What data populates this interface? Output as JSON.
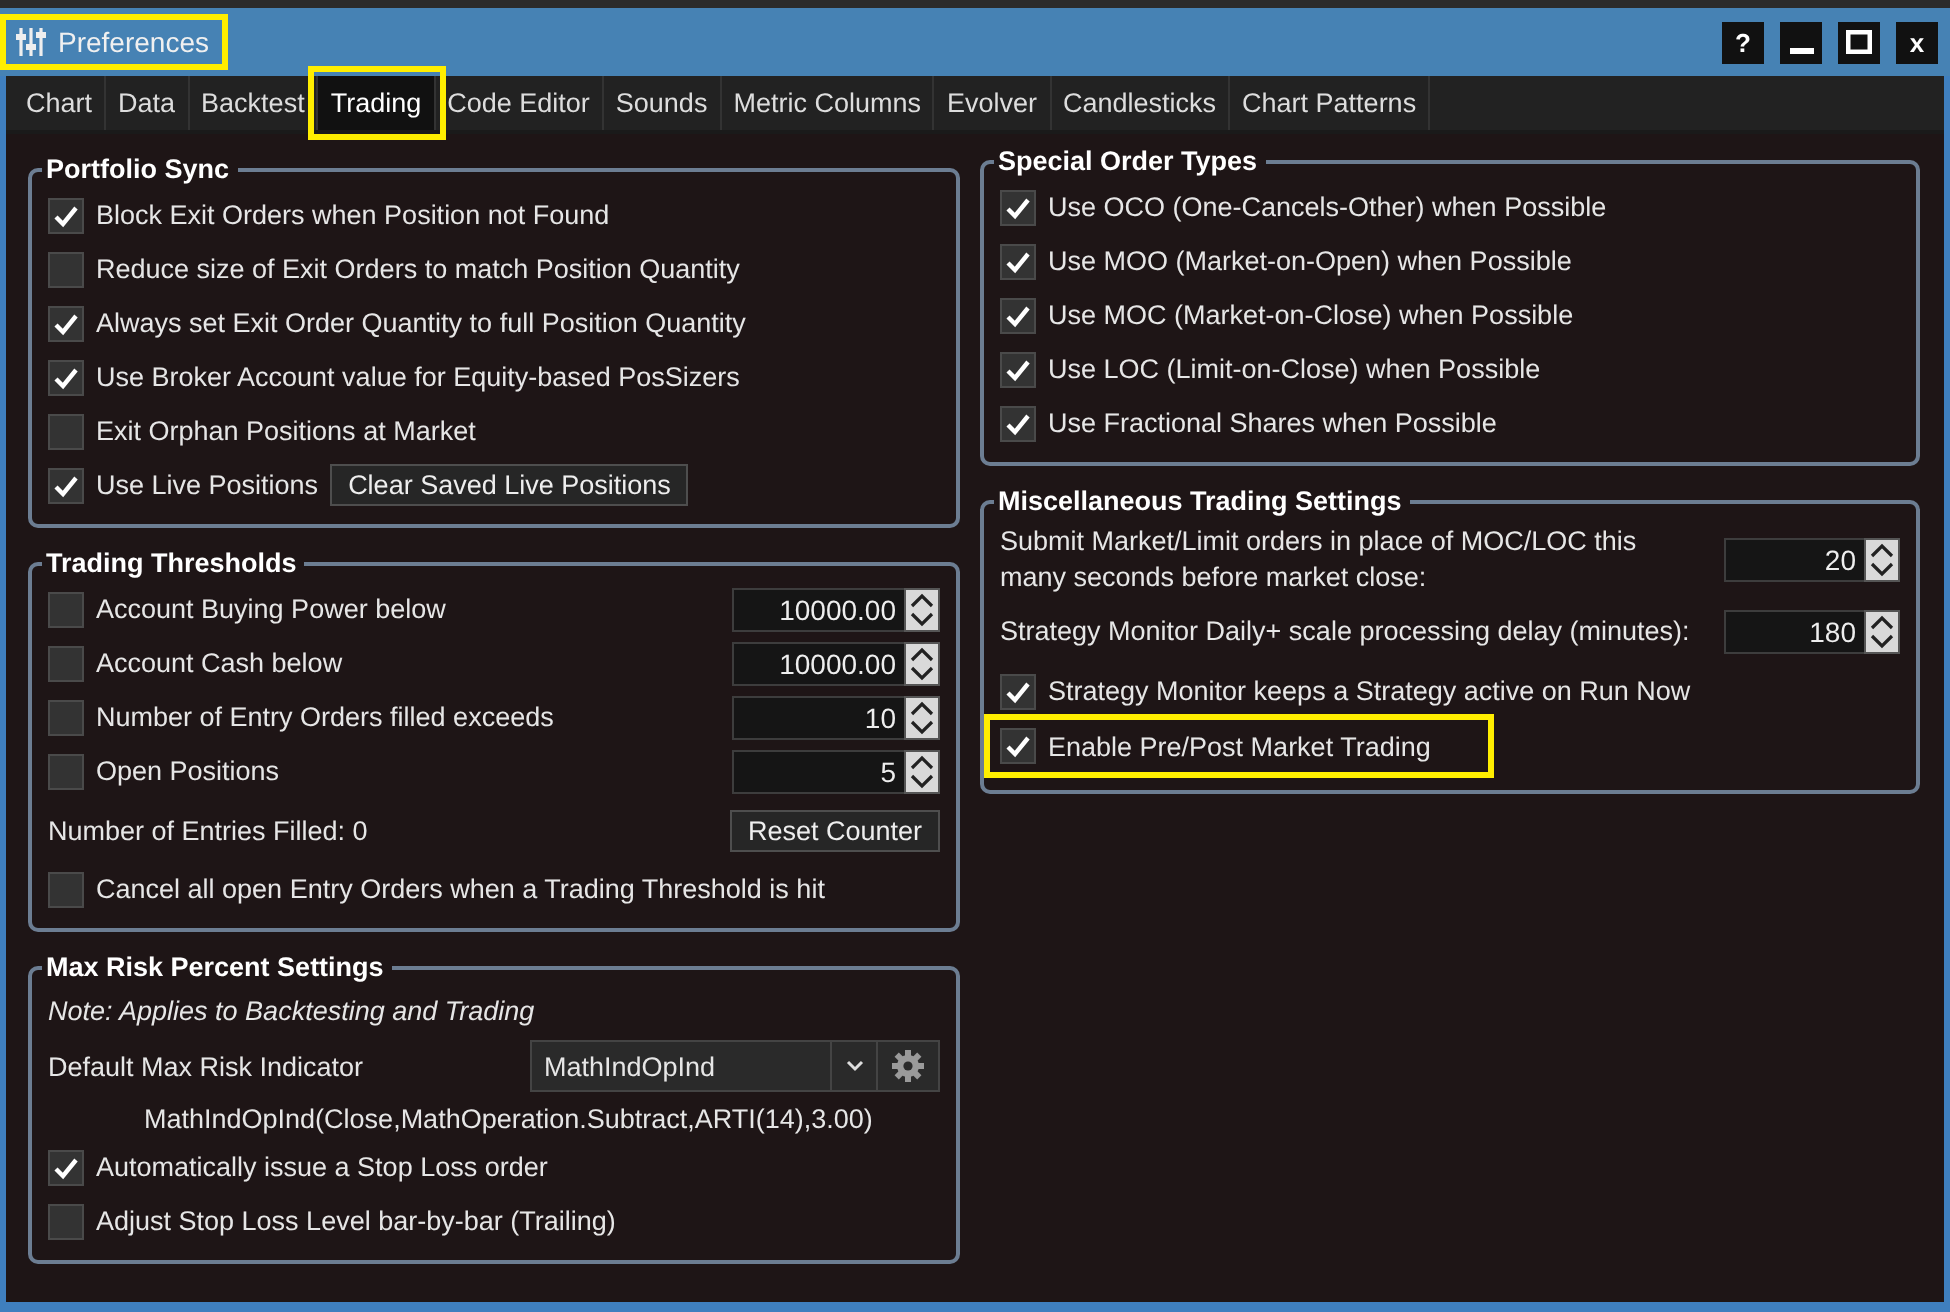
{
  "window": {
    "title": "Preferences",
    "highlighted": true,
    "help_button": "?",
    "close_button": "x"
  },
  "tabs": [
    {
      "label": "Chart",
      "selected": false,
      "highlighted": false
    },
    {
      "label": "Data",
      "selected": false,
      "highlighted": false
    },
    {
      "label": "Backtest",
      "selected": false,
      "highlighted": false
    },
    {
      "label": "Trading",
      "selected": true,
      "highlighted": true
    },
    {
      "label": "Code Editor",
      "selected": false,
      "highlighted": false
    },
    {
      "label": "Sounds",
      "selected": false,
      "highlighted": false
    },
    {
      "label": "Metric Columns",
      "selected": false,
      "highlighted": false
    },
    {
      "label": "Evolver",
      "selected": false,
      "highlighted": false
    },
    {
      "label": "Candlesticks",
      "selected": false,
      "highlighted": false
    },
    {
      "label": "Chart Patterns",
      "selected": false,
      "highlighted": false
    }
  ],
  "left_column": [
    {
      "title": "Portfolio Sync",
      "rows": [
        {
          "kind": "checkbox",
          "label": "Block Exit Orders when Position not Found",
          "checked": true,
          "highlighted": false
        },
        {
          "kind": "checkbox",
          "label": "Reduce size of Exit Orders to match Position Quantity",
          "checked": false,
          "highlighted": false
        },
        {
          "kind": "checkbox",
          "label": "Always set Exit Order Quantity to full Position Quantity",
          "checked": true,
          "highlighted": false
        },
        {
          "kind": "checkbox",
          "label": "Use Broker Account value for Equity-based PosSizers",
          "checked": true,
          "highlighted": false
        },
        {
          "kind": "checkbox",
          "label": "Exit Orphan Positions at Market",
          "checked": false,
          "highlighted": false
        },
        {
          "kind": "checkbox_button",
          "label": "Use Live Positions",
          "checked": true,
          "button": "Clear Saved Live Positions",
          "highlighted": false
        }
      ]
    },
    {
      "title": "Trading Thresholds",
      "rows": [
        {
          "kind": "checkbox_spin",
          "label": "Account Buying Power below",
          "checked": false,
          "value": "10000.00",
          "highlighted": false
        },
        {
          "kind": "checkbox_spin",
          "label": "Account Cash below",
          "checked": false,
          "value": "10000.00",
          "highlighted": false
        },
        {
          "kind": "checkbox_spin",
          "label": "Number of Entry Orders filled exceeds",
          "checked": false,
          "value": "10",
          "highlighted": false
        },
        {
          "kind": "checkbox_spin",
          "label": "Open Positions",
          "checked": false,
          "value": "5",
          "highlighted": false
        },
        {
          "kind": "text_button",
          "label": "Number of Entries Filled: 0",
          "button": "Reset Counter",
          "highlighted": false
        },
        {
          "kind": "checkbox",
          "label": "Cancel all open Entry Orders when a Trading Threshold is hit",
          "checked": false,
          "highlighted": false
        }
      ]
    },
    {
      "title": "Max Risk Percent Settings",
      "rows": [
        {
          "kind": "note",
          "label": "Note: Applies to Backtesting and Trading",
          "highlighted": false
        },
        {
          "kind": "dropdown",
          "label": "Default Max Risk Indicator",
          "value": "MathIndOpInd",
          "highlighted": false
        },
        {
          "kind": "expression",
          "label": "MathIndOpInd(Close,MathOperation.Subtract,ARTI(14),3.00)",
          "highlighted": false
        },
        {
          "kind": "checkbox",
          "label": "Automatically issue a Stop Loss order",
          "checked": true,
          "highlighted": false
        },
        {
          "kind": "checkbox",
          "label": "Adjust Stop Loss Level bar-by-bar (Trailing)",
          "checked": false,
          "highlighted": false
        }
      ]
    }
  ],
  "right_column": [
    {
      "title": "Special Order Types",
      "rows": [
        {
          "kind": "checkbox",
          "label": "Use OCO (One-Cancels-Other) when Possible",
          "checked": true,
          "highlighted": false
        },
        {
          "kind": "checkbox",
          "label": "Use MOO (Market-on-Open) when Possible",
          "checked": true,
          "highlighted": false
        },
        {
          "kind": "checkbox",
          "label": "Use MOC (Market-on-Close) when Possible",
          "checked": true,
          "highlighted": false
        },
        {
          "kind": "checkbox",
          "label": "Use LOC (Limit-on-Close) when Possible",
          "checked": true,
          "highlighted": false
        },
        {
          "kind": "checkbox",
          "label": "Use Fractional Shares when Possible",
          "checked": true,
          "highlighted": false
        }
      ]
    },
    {
      "title": "Miscellaneous Trading Settings",
      "rows": [
        {
          "kind": "spin",
          "label": "Submit Market/Limit orders in place of MOC/LOC this many seconds before market close:",
          "value": "20",
          "highlighted": false
        },
        {
          "kind": "spin",
          "label": "Strategy Monitor Daily+ scale processing delay (minutes):",
          "value": "180",
          "highlighted": false
        },
        {
          "kind": "checkbox",
          "label": "Strategy Monitor keeps a Strategy active on Run Now",
          "checked": true,
          "highlighted": false
        },
        {
          "kind": "checkbox",
          "label": "Enable Pre/Post Market Trading",
          "checked": true,
          "highlighted": true
        }
      ]
    }
  ]
}
